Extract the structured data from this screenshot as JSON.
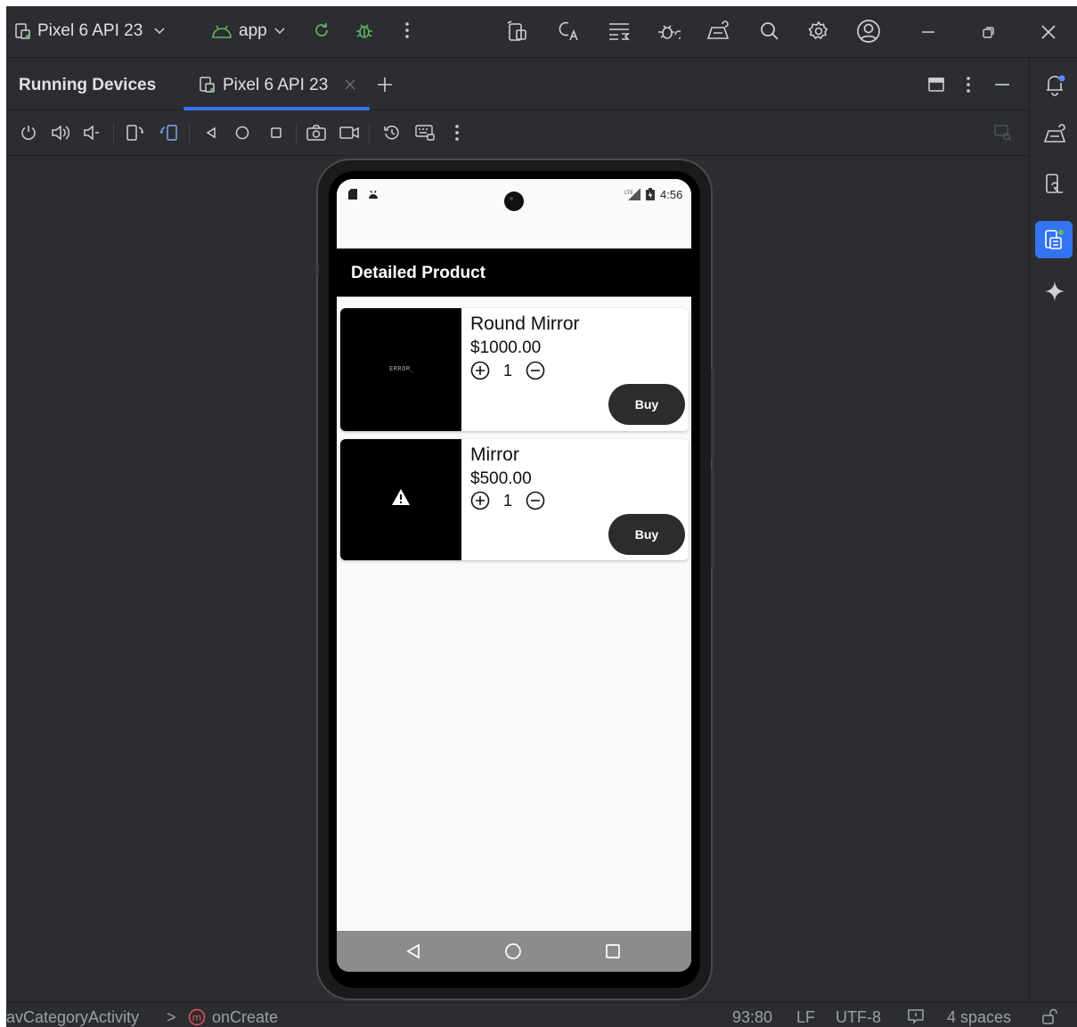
{
  "titlebar": {
    "device_selector": "Pixel 6 API 23",
    "run_config": "app"
  },
  "tool_window": {
    "title": "Running Devices",
    "tab_label": "Pixel 6 API 23"
  },
  "device": {
    "status_time": "4:56",
    "app_title": "Detailed Product",
    "error_placeholder": "ERROR_",
    "products": [
      {
        "name": "Round Mirror",
        "price": "$1000.00",
        "quantity": "1",
        "buy_label": "Buy"
      },
      {
        "name": "Mirror",
        "price": "$500.00",
        "quantity": "1",
        "buy_label": "Buy"
      }
    ]
  },
  "statusbar": {
    "breadcrumb_class": "avCategoryActivity",
    "breadcrumb_separator": ">",
    "breadcrumb_method": "onCreate",
    "cursor_position": "93:80",
    "line_separator": "LF",
    "encoding": "UTF-8",
    "indent": "4 spaces"
  },
  "colors": {
    "ide_bg": "#2b2d30",
    "accent": "#3574f0",
    "app_bar": "#000000",
    "buy_button": "#2c2c2c"
  }
}
